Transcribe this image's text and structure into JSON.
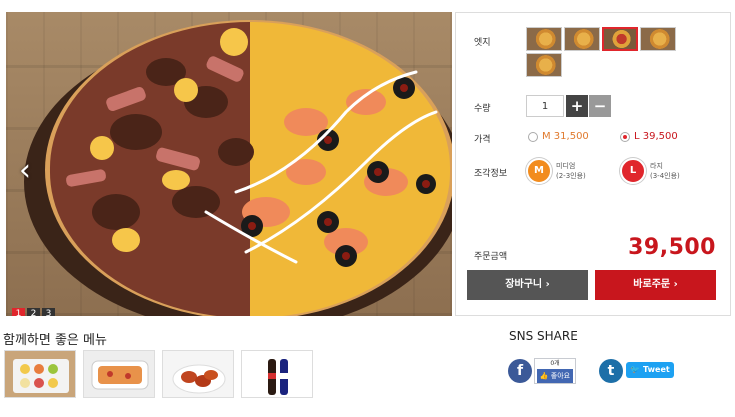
{
  "hero": {
    "prev_icon": "chevron-left-icon",
    "pages": [
      "1",
      "2",
      "3"
    ],
    "active_page": 1
  },
  "options": {
    "edge_label": "엣지",
    "edge_thumbs": 5,
    "edge_selected_index": 2,
    "qty_label": "수량",
    "qty_value": "1",
    "plus_label": "+",
    "minus_label": "−",
    "price_label": "가격",
    "prices": [
      {
        "label": "M 31,500",
        "selected": false
      },
      {
        "label": "L 39,500",
        "selected": true
      }
    ],
    "slice_label": "조각정보",
    "sizes": [
      {
        "code": "M",
        "name": "미디엄",
        "serving": "(2-3인용)",
        "color": "#f28c1e"
      },
      {
        "code": "L",
        "name": "라지",
        "serving": "(3-4인용)",
        "color": "#e0262c"
      }
    ],
    "total_label": "주문금액",
    "total_value": "39,500",
    "cart_button": "장바구니 ›",
    "order_button": "바로주문 ›"
  },
  "recommend": {
    "title": "함께하면 좋은 메뉴",
    "items": [
      "side-platter",
      "baked-pasta",
      "chicken-wings",
      "soda-bottles"
    ]
  },
  "sns": {
    "title": "SNS SHARE",
    "fb_icon": "f",
    "like_count": "0개",
    "like_label": "👍 좋아요",
    "tw_icon": "t",
    "tweet_label": "🐦 Tweet"
  },
  "colors": {
    "accent": "#c8161d",
    "dark_button": "#555555",
    "facebook": "#3b5998",
    "twitter": "#1da1f2"
  }
}
